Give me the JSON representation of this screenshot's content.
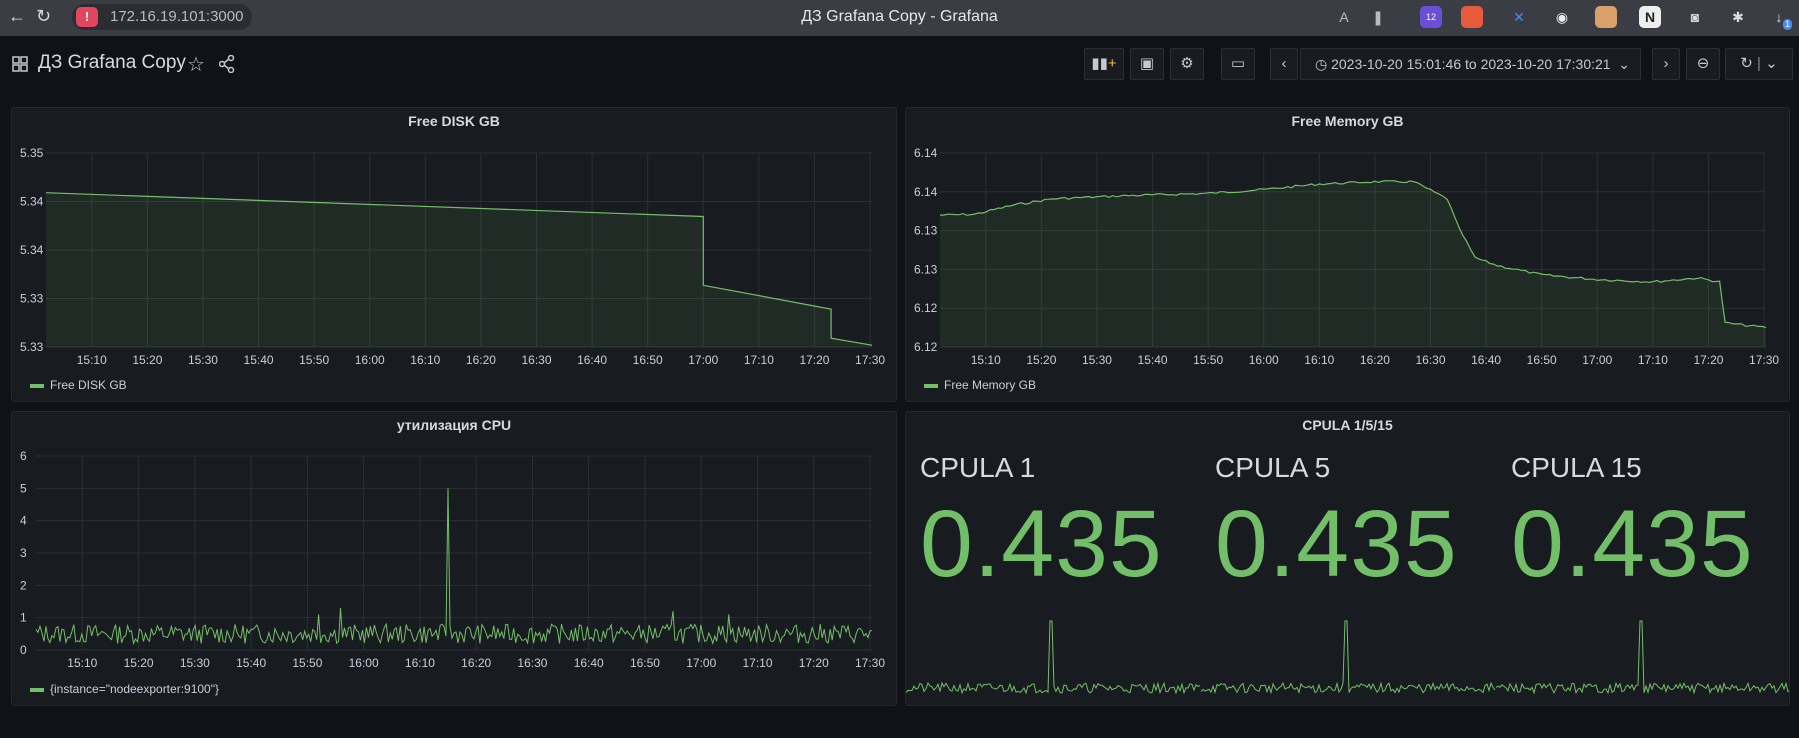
{
  "browser": {
    "url": "172.16.19.101:3000",
    "window_title": "ДЗ Grafana Copy - Grafana",
    "ext_badge_count": "12",
    "ext_badge_count2": "1"
  },
  "dashboard": {
    "title": "ДЗ Grafana Copy",
    "time_range": "2023-10-20 15:01:46 to 2023-10-20 17:30:21"
  },
  "colors": {
    "series": "#73bf69",
    "bg": "#111217",
    "panel": "#181b1f",
    "grid": "#2c2f35"
  },
  "panels": {
    "disk": {
      "title": "Free DISK GB",
      "legend": "Free DISK GB"
    },
    "memory": {
      "title": "Free Memory GB",
      "legend": "Free Memory GB"
    },
    "cpu": {
      "title": "утилизация CPU",
      "legend": "{instance=\"nodeexporter:9100\"}"
    },
    "cpula": {
      "title": "CPULA 1/5/15",
      "stats": [
        {
          "name": "CPULA 1",
          "value": "0.435"
        },
        {
          "name": "CPULA 5",
          "value": "0.435"
        },
        {
          "name": "CPULA 15",
          "value": "0.435"
        }
      ]
    }
  },
  "chart_data": [
    {
      "type": "area",
      "title": "Free DISK GB",
      "x_ticks": [
        "15:10",
        "15:20",
        "15:30",
        "15:40",
        "15:50",
        "16:00",
        "16:10",
        "16:20",
        "16:30",
        "16:40",
        "16:50",
        "17:00",
        "17:10",
        "17:20",
        "17:30"
      ],
      "y_ticks": [
        "5.33",
        "5.33",
        "5.34",
        "5.34",
        "5.35"
      ],
      "ylim": [
        5.328,
        5.35
      ],
      "series": [
        {
          "name": "Free DISK GB",
          "x": [
            "15:02",
            "17:00",
            "17:00",
            "17:23",
            "17:23",
            "17:30"
          ],
          "y": [
            5.3455,
            5.3428,
            5.335,
            5.3323,
            5.329,
            5.3282
          ]
        }
      ]
    },
    {
      "type": "area",
      "title": "Free Memory GB",
      "x_ticks": [
        "15:10",
        "15:20",
        "15:30",
        "15:40",
        "15:50",
        "16:00",
        "16:10",
        "16:20",
        "16:30",
        "16:40",
        "16:50",
        "17:00",
        "17:10",
        "17:20",
        "17:30"
      ],
      "y_ticks": [
        "6.12",
        "6.12",
        "6.13",
        "6.13",
        "6.14",
        "6.14"
      ],
      "ylim": [
        6.1175,
        6.1425
      ],
      "series": [
        {
          "name": "Free Memory GB",
          "x": [
            "15:02",
            "15:08",
            "15:15",
            "15:22",
            "15:35",
            "15:50",
            "16:00",
            "16:10",
            "16:20",
            "16:27",
            "16:33",
            "16:35",
            "16:38",
            "16:42",
            "16:50",
            "17:00",
            "17:10",
            "17:18",
            "17:22",
            "17:23",
            "17:30"
          ],
          "y": [
            6.1345,
            6.1346,
            6.1358,
            6.1366,
            6.137,
            6.1373,
            6.1378,
            6.1385,
            6.1388,
            6.1388,
            6.1366,
            6.133,
            6.129,
            6.128,
            6.1268,
            6.1262,
            6.1259,
            6.1264,
            6.1259,
            6.1206,
            6.12
          ]
        }
      ]
    },
    {
      "type": "line",
      "title": "утилизация CPU",
      "x_ticks": [
        "15:10",
        "15:20",
        "15:30",
        "15:40",
        "15:50",
        "16:00",
        "16:10",
        "16:20",
        "16:30",
        "16:40",
        "16:50",
        "17:00",
        "17:10",
        "17:20",
        "17:30"
      ],
      "y_ticks": [
        "0",
        "1",
        "2",
        "3",
        "4",
        "5",
        "6"
      ],
      "ylim": [
        0,
        6
      ],
      "series": [
        {
          "name": "{instance=\"nodeexporter:9100\"}",
          "baseline": 0.5,
          "noise": 0.3,
          "spikes": [
            {
              "x": "16:15",
              "y": 5.0
            },
            {
              "x": "15:56",
              "y": 1.3
            },
            {
              "x": "16:55",
              "y": 1.2
            },
            {
              "x": "15:52",
              "y": 1.1
            },
            {
              "x": "17:05",
              "y": 1.1
            }
          ]
        }
      ]
    }
  ]
}
